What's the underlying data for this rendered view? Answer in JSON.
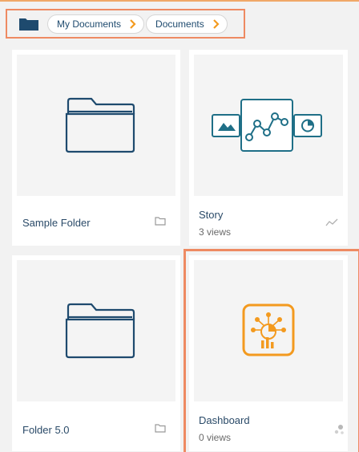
{
  "breadcrumb": {
    "items": [
      {
        "label": "My Documents"
      },
      {
        "label": "Documents"
      }
    ]
  },
  "cards": [
    {
      "title": "Sample Folder",
      "type_icon": "folder-icon"
    },
    {
      "title": "Story",
      "views": "3 views",
      "type_icon": "trend-line-icon"
    },
    {
      "title": "Folder 5.0",
      "type_icon": "folder-icon"
    },
    {
      "title": "Dashboard",
      "views": "0 views",
      "type_icon": "dashboard-dots-icon"
    }
  ],
  "colors": {
    "accent": "#ee8a62",
    "icon_blue": "#1e4a6e",
    "story_teal": "#1f6f87",
    "dashboard_orange": "#f39a1f"
  }
}
